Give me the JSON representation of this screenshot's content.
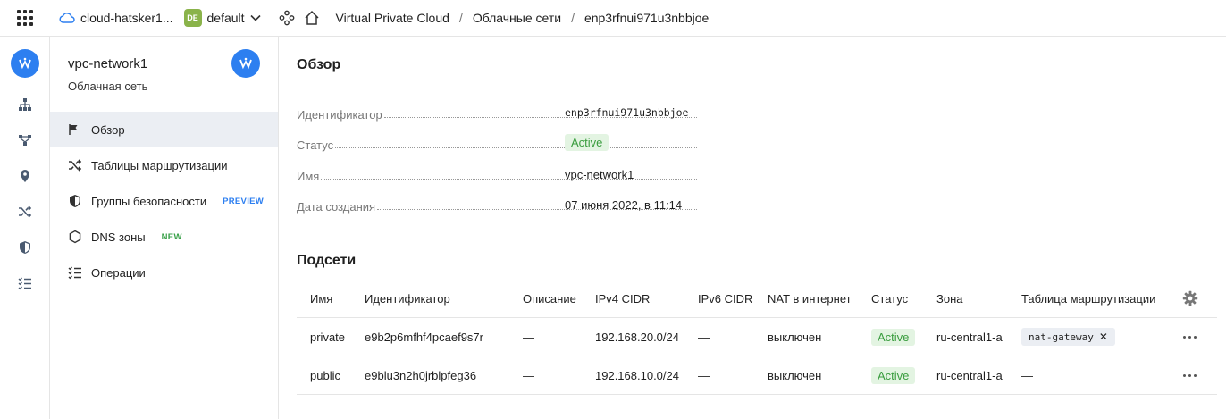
{
  "topbar": {
    "cloud_name": "cloud-hatsker1...",
    "folder_badge": "DE",
    "folder_name": "default",
    "breadcrumbs": [
      "Virtual Private Cloud",
      "Облачные сети",
      "enp3rfnui971u3nbbjoe"
    ]
  },
  "sidenav": {
    "title": "vpc-network1",
    "subtitle": "Облачная сеть",
    "items": [
      {
        "label": "Обзор",
        "icon": "flag-icon",
        "active": true
      },
      {
        "label": "Таблицы маршрутизации",
        "icon": "shuffle-icon"
      },
      {
        "label": "Группы безопасности",
        "icon": "shield-icon",
        "tag": "PREVIEW"
      },
      {
        "label": "DNS зоны",
        "icon": "hexagon-icon",
        "tag": "NEW"
      },
      {
        "label": "Операции",
        "icon": "list-check-icon"
      }
    ]
  },
  "overview": {
    "title": "Обзор",
    "fields": [
      {
        "key": "Идентификатор",
        "value": "enp3rfnui971u3nbbjoe"
      },
      {
        "key": "Статус",
        "value": "Active"
      },
      {
        "key": "Имя",
        "value": "vpc-network1"
      },
      {
        "key": "Дата создания",
        "value": "07 июня 2022, в 11:14"
      }
    ]
  },
  "subnets": {
    "title": "Подсети",
    "columns": [
      "Имя",
      "Идентификатор",
      "Описание",
      "IPv4 CIDR",
      "IPv6 CIDR",
      "NAT в интернет",
      "Статус",
      "Зона",
      "Таблица маршрутизации"
    ],
    "rows": [
      {
        "name": "private",
        "id": "e9b2p6mfhf4pcaef9s7r",
        "desc": "—",
        "ipv4": "192.168.20.0/24",
        "ipv6": "—",
        "nat": "выключен",
        "status": "Active",
        "zone": "ru-central1-a",
        "route_table": "nat-gateway"
      },
      {
        "name": "public",
        "id": "e9blu3n2h0jrblpfeg36",
        "desc": "—",
        "ipv4": "192.168.10.0/24",
        "ipv6": "—",
        "nat": "выключен",
        "status": "Active",
        "zone": "ru-central1-a",
        "route_table": "—"
      }
    ]
  },
  "colors": {
    "accent": "#2d7ff0",
    "active_bg": "#e3f4e2",
    "active_text": "#3a9d3f",
    "folder_badge": "#8ab34a"
  }
}
